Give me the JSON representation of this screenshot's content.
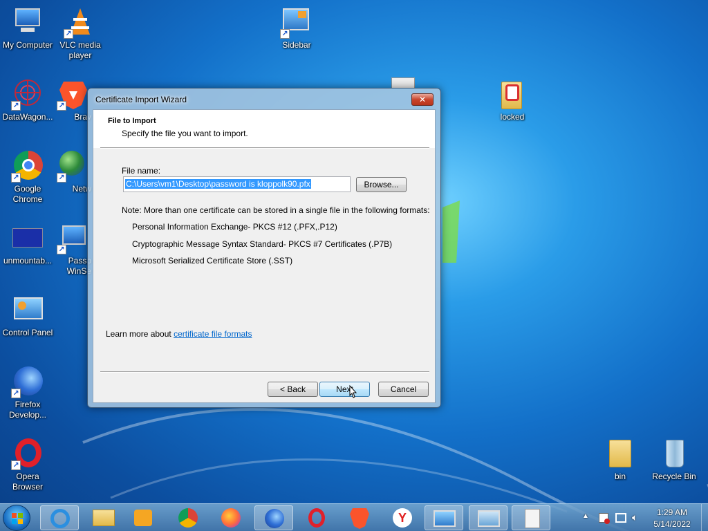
{
  "desktop": {
    "icons": [
      {
        "label": "My Computer"
      },
      {
        "label": "VLC media player"
      },
      {
        "label": "Sidebar"
      },
      {
        "label": "DataWagon..."
      },
      {
        "label": "Brav"
      },
      {
        "label": "locked"
      },
      {
        "label": "Google Chrome"
      },
      {
        "label": "Netw"
      },
      {
        "label": "unmountab..."
      },
      {
        "label": "Passp WinSe"
      },
      {
        "label": "Control Panel"
      },
      {
        "label": "Firefox Develop..."
      },
      {
        "label": "Opera Browser"
      },
      {
        "label": "bin"
      },
      {
        "label": "Recycle Bin"
      }
    ]
  },
  "dialog": {
    "title": "Certificate Import Wizard",
    "close_label": "✕",
    "header_title": "File to Import",
    "header_subtitle": "Specify the file you want to import.",
    "file_name_label": "File name:",
    "file_name_value": "C:\\Users\\vm1\\Desktop\\password is kloppolk90.pfx",
    "browse_label": "Browse...",
    "note": "Note:  More than one certificate can be stored in a single file in the following formats:",
    "formats": [
      "Personal Information Exchange- PKCS #12 (.PFX,.P12)",
      "Cryptographic Message Syntax Standard- PKCS #7 Certificates (.P7B)",
      "Microsoft Serialized Certificate Store (.SST)"
    ],
    "learn_more_prefix": "Learn more about",
    "learn_more_link": "certificate file formats",
    "back_label": "< Back",
    "next_label": "Next",
    "cancel_label": "Cancel"
  },
  "taskbar": {
    "pinned": [
      "ie-icon",
      "explorer-icon",
      "media-player-icon",
      "chrome-icon",
      "firefox-icon",
      "firefox-dev-icon",
      "opera-icon",
      "brave-icon",
      "yandex-icon",
      "control-panel-icon",
      "certificate-icon",
      "document-icon"
    ],
    "clock_time": "1:29 AM",
    "clock_date": "5/14/2022"
  },
  "colors": {
    "accent": "#3399ff",
    "link": "#0066cc",
    "close": "#c9462c"
  }
}
